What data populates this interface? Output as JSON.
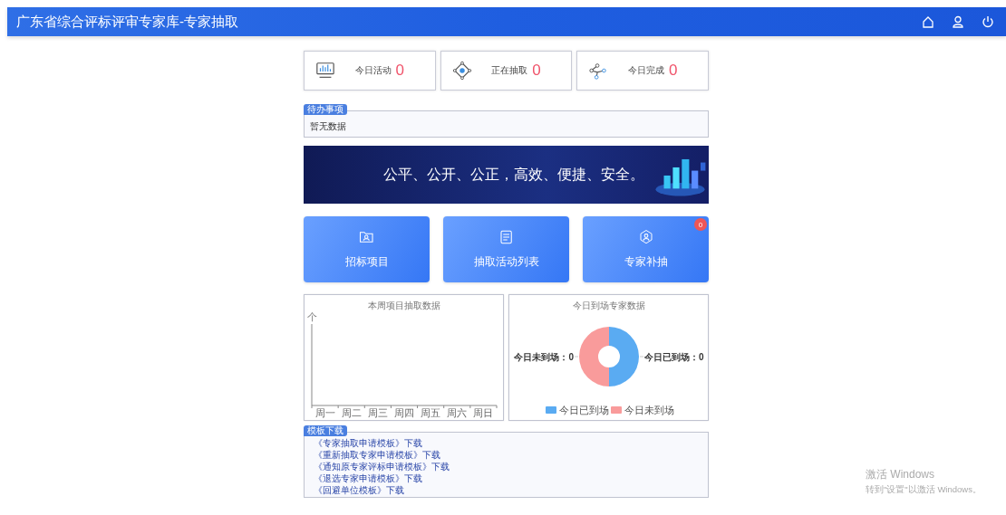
{
  "header": {
    "title": "广东省综合评标评审专家库-专家抽取"
  },
  "stats": [
    {
      "label": "今日活动",
      "value": "0"
    },
    {
      "label": "正在抽取",
      "value": "0"
    },
    {
      "label": "今日完成",
      "value": "0"
    }
  ],
  "todo": {
    "title": "待办事项",
    "empty_text": "暂无数据"
  },
  "banner": {
    "slogan": "公平、公开、公正，高效、便捷、安全。"
  },
  "tiles": [
    {
      "label": "招标项目"
    },
    {
      "label": "抽取活动列表"
    },
    {
      "label": "专家补抽",
      "badge": "0"
    }
  ],
  "week_chart": {
    "title": "本周项目抽取数据",
    "unit_label": "个",
    "axis_labels": [
      "周一",
      "周二",
      "周三",
      "周四",
      "周五",
      "周六",
      "周日"
    ]
  },
  "attendance_chart": {
    "title": "今日到场专家数据",
    "slice_labels": [
      "今日未到场：0",
      "今日已到场：0"
    ],
    "legend": [
      {
        "label": "今日已到场",
        "color": "#5aabf2"
      },
      {
        "label": "今日未到场",
        "color": "#f99b9b"
      }
    ]
  },
  "templates": {
    "title": "模板下载",
    "links": [
      "《专家抽取申请模板》下载",
      "《重新抽取专家申请模板》下载",
      "《通知原专家评标申请模板》下载",
      "《退选专家申请模板》下载",
      "《回避单位模板》下载"
    ]
  },
  "os_notice": {
    "title": "激活 Windows",
    "subtitle": "转到\"设置\"以激活 Windows。"
  }
}
